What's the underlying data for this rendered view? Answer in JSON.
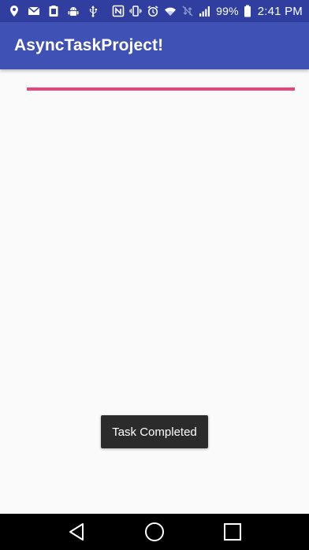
{
  "status_bar": {
    "battery_percent": "99%",
    "time": "2:41 PM",
    "left_icons": [
      "location-icon",
      "gmail-icon",
      "clipboard-icon",
      "android-debug-icon",
      "usb-icon"
    ],
    "right_icons": [
      "nfc-icon",
      "vibrate-icon",
      "alarm-icon",
      "wifi-icon",
      "no-data-icon",
      "signal-icon",
      "battery-icon"
    ],
    "color": "#303f9f"
  },
  "app_bar": {
    "title": "AsyncTaskProject!",
    "color": "#3f51b5"
  },
  "progress": {
    "value_percent": 100,
    "fill_color": "#e8457a",
    "track_color": "#f5c2d3"
  },
  "toast": {
    "message": "Task Completed"
  },
  "nav_bar": {
    "buttons": [
      "back-icon",
      "home-icon",
      "recents-icon"
    ]
  }
}
